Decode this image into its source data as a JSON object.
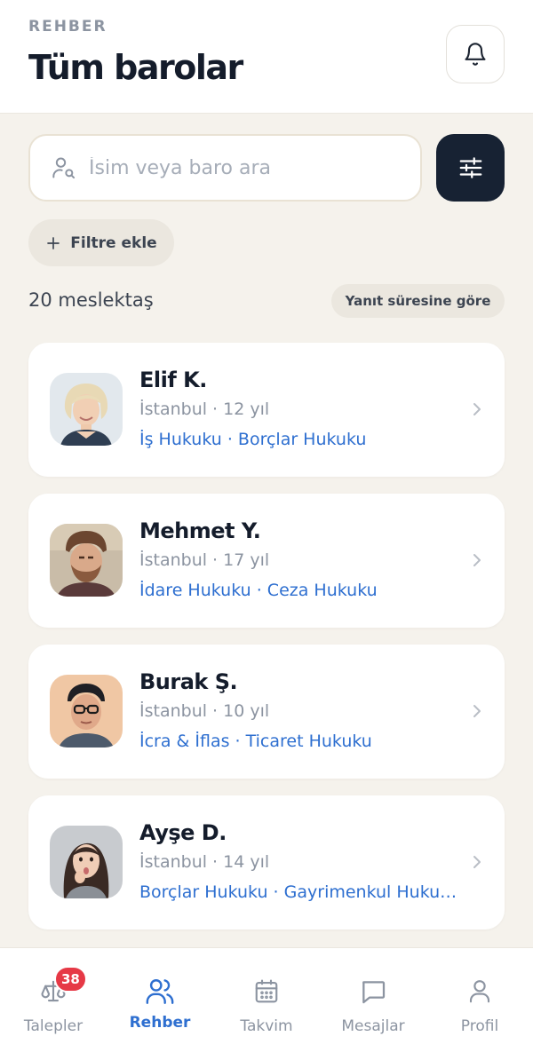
{
  "header": {
    "eyebrow": "REHBER",
    "title": "Tüm barolar",
    "bell_icon": "bell-icon"
  },
  "search": {
    "placeholder": "İsim veya baro ara",
    "value": "",
    "icon": "user-search-icon"
  },
  "filter_button_icon": "sliders-icon",
  "add_filter_label": "Filtre ekle",
  "result_count": "20 meslektaş",
  "sort_label": "Yanıt süresine göre",
  "lawyers": [
    {
      "name": "Elif K.",
      "meta": "İstanbul · 12 yıl",
      "tags": "İş Hukuku · Borçlar Hukuku"
    },
    {
      "name": "Mehmet Y.",
      "meta": "İstanbul · 17 yıl",
      "tags": "İdare Hukuku · Ceza Hukuku"
    },
    {
      "name": "Burak Ş.",
      "meta": "İstanbul · 10 yıl",
      "tags": "İcra & İflas · Ticaret Hukuku"
    },
    {
      "name": "Ayşe D.",
      "meta": "İstanbul · 14 yıl",
      "tags": "Borçlar Hukuku · Gayrimenkul Hukuku"
    }
  ],
  "tabs": [
    {
      "label": "Talepler",
      "icon": "scales-icon",
      "badge": "38",
      "active": false
    },
    {
      "label": "Rehber",
      "icon": "users-icon",
      "active": true
    },
    {
      "label": "Takvim",
      "icon": "calendar-icon",
      "active": false
    },
    {
      "label": "Mesajlar",
      "icon": "message-icon",
      "active": false
    },
    {
      "label": "Profil",
      "icon": "user-icon",
      "active": false
    }
  ],
  "colors": {
    "accent": "#2e6fd0",
    "dark": "#172233",
    "background": "#f5f2ec",
    "badge": "#e63946"
  }
}
